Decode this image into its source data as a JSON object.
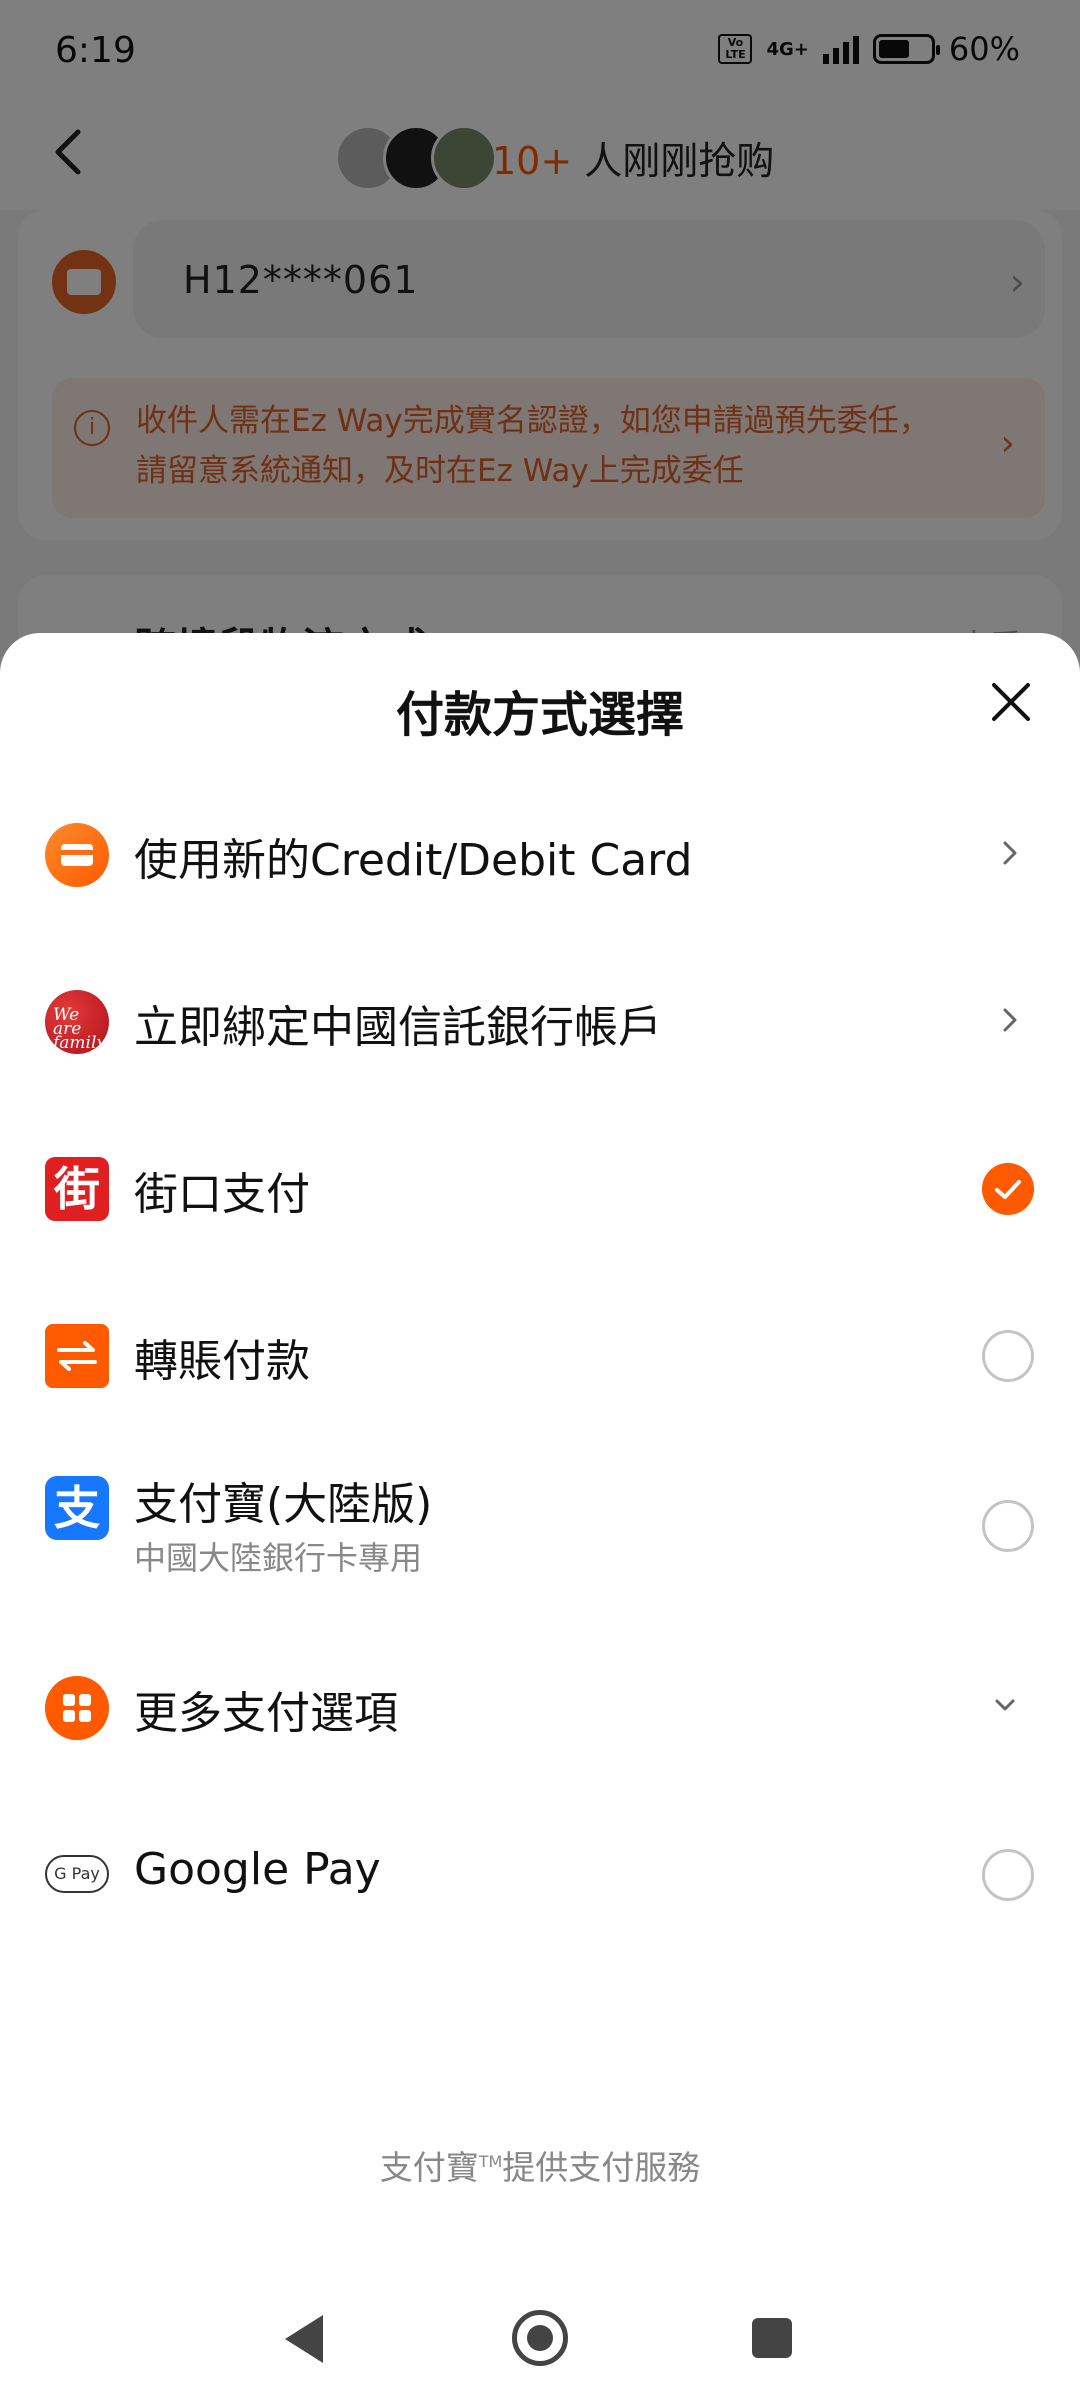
{
  "status_bar": {
    "time": "6:19",
    "network": "4G+",
    "volte": "Vo LTE",
    "battery": "60%",
    "battery_level": 0.6
  },
  "top_nav": {
    "buyers_count": "10+",
    "buyers_text": " 人刚刚抢购"
  },
  "id_section": {
    "id_number": "H12****061",
    "notice": "收件人需在Ez Way完成實名認證，如您申請過預先委任，請留意系統通知，及时在Ez Way上完成委任"
  },
  "logistics_section": {
    "title": "跨境段物流方式",
    "right_label": "查看"
  },
  "payment_sheet": {
    "title": "付款方式選擇",
    "options": [
      {
        "label": "使用新的Credit/Debit Card",
        "control": "chevron",
        "icon": "credit-card-icon"
      },
      {
        "label": "立即綁定中國信託銀行帳戶",
        "control": "chevron",
        "icon": "ctbc-bank-icon",
        "icon_text": "We are family"
      },
      {
        "label": "街口支付",
        "control": "radio",
        "selected": true,
        "icon": "jko-pay-icon",
        "icon_text": "街"
      },
      {
        "label": "轉賬付款",
        "control": "radio",
        "selected": false,
        "icon": "transfer-icon"
      },
      {
        "label": "支付寶(大陸版)",
        "sublabel": "中國大陸銀行卡專用",
        "control": "radio",
        "selected": false,
        "icon": "alipay-icon",
        "icon_text": "支"
      },
      {
        "label": "更多支付選項",
        "control": "expand",
        "icon": "more-options-icon"
      },
      {
        "label": "Google Pay",
        "control": "radio",
        "selected": false,
        "icon": "google-pay-icon",
        "icon_text": "G Pay"
      }
    ],
    "footer": {
      "brand": "支付寶",
      "trademark": "TM",
      "text": "提供支付服務"
    }
  },
  "colors": {
    "accent": "#ff5a00",
    "notice_text": "#e0612a"
  }
}
